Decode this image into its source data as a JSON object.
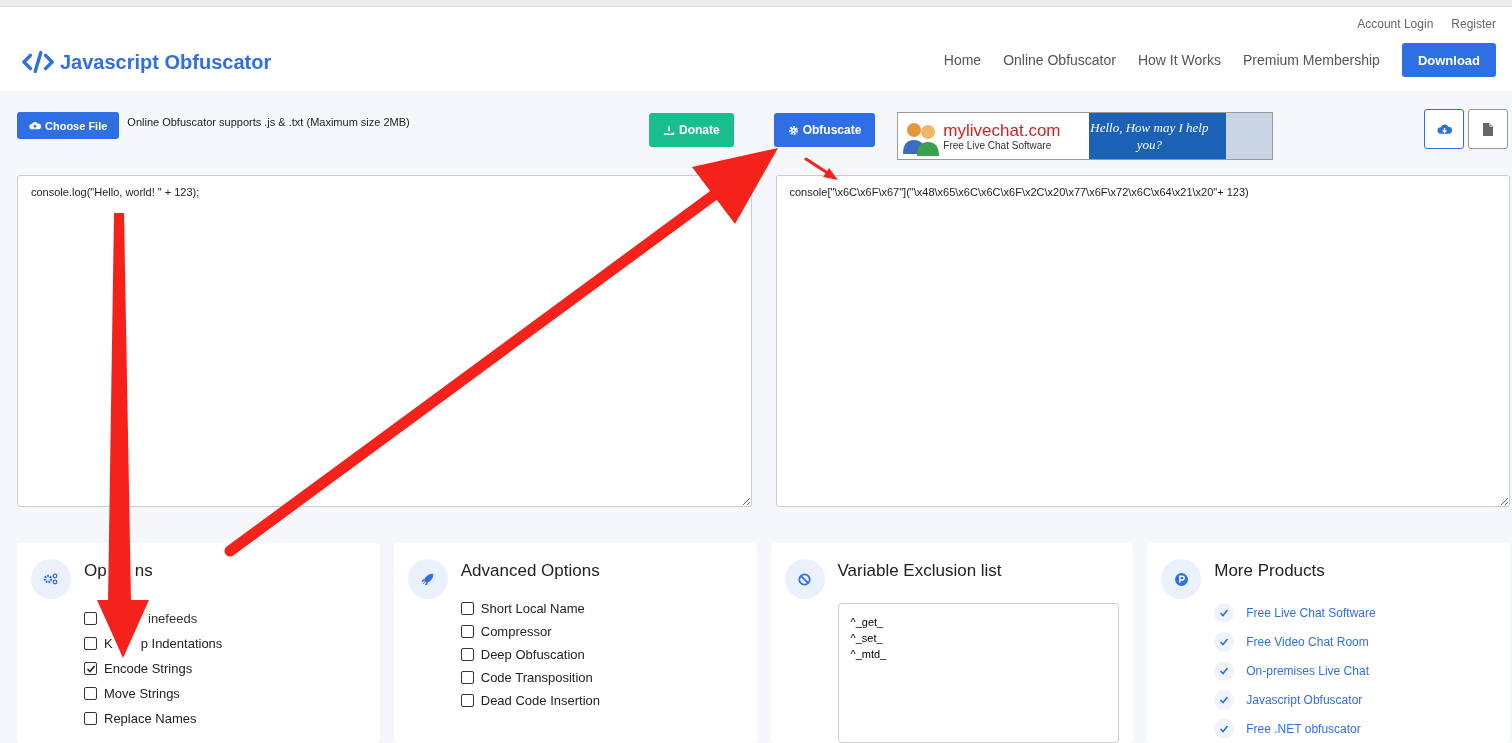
{
  "header": {
    "brand": "Javascript Obfuscator",
    "top_links": [
      "Account Login",
      "Register"
    ],
    "nav": [
      "Home",
      "Online Obfuscator",
      "How It Works",
      "Premium Membership"
    ],
    "download": "Download"
  },
  "toolbar": {
    "choose_file": "Choose File",
    "note": "Online Obfuscator supports .js & .txt (Maximum size 2MB)",
    "donate": "Donate",
    "obfuscate": "Obfuscate",
    "ad": {
      "headline": "mylivechat.com",
      "subline": "Free Live Chat Software",
      "greeting": "Hello, How may I help you?"
    }
  },
  "input_code": "console.log(\"Hello, world! \" + 123);",
  "output_code": "console[\"\\x6C\\x6F\\x67\"](\"\\x48\\x65\\x6C\\x6C\\x6F\\x2C\\x20\\x77\\x6F\\x72\\x6C\\x64\\x21\\x20\"+ 123)",
  "options": {
    "title_parts": [
      "Op",
      "ns"
    ],
    "items": [
      {
        "parts": [
          "inefeeds"
        ],
        "start_covered": true,
        "checked": false
      },
      {
        "parts": [
          "K",
          "p Indentations"
        ],
        "start_covered": false,
        "checked": false
      },
      {
        "parts": [
          "Encode Strings"
        ],
        "start_covered": false,
        "checked": true
      },
      {
        "parts": [
          "Move Strings"
        ],
        "start_covered": false,
        "checked": false
      },
      {
        "parts": [
          "Replace Names"
        ],
        "start_covered": false,
        "checked": false
      }
    ]
  },
  "advanced": {
    "title": "Advanced Options",
    "items": [
      {
        "label": "Short Local Name",
        "checked": false
      },
      {
        "label": "Compressor",
        "checked": false
      },
      {
        "label": "Deep Obfuscation",
        "checked": false
      },
      {
        "label": "Code Transposition",
        "checked": false
      },
      {
        "label": "Dead Code Insertion",
        "checked": false
      }
    ]
  },
  "exclusion": {
    "title": "Variable Exclusion list",
    "value": "^_get_\n^_set_\n^_mtd_"
  },
  "products": {
    "title": "More Products",
    "items": [
      "Free Live Chat Software",
      "Free Video Chat Room",
      "On-premises Live Chat",
      "Javascript Obfuscator",
      "Free .NET obfuscator"
    ]
  }
}
